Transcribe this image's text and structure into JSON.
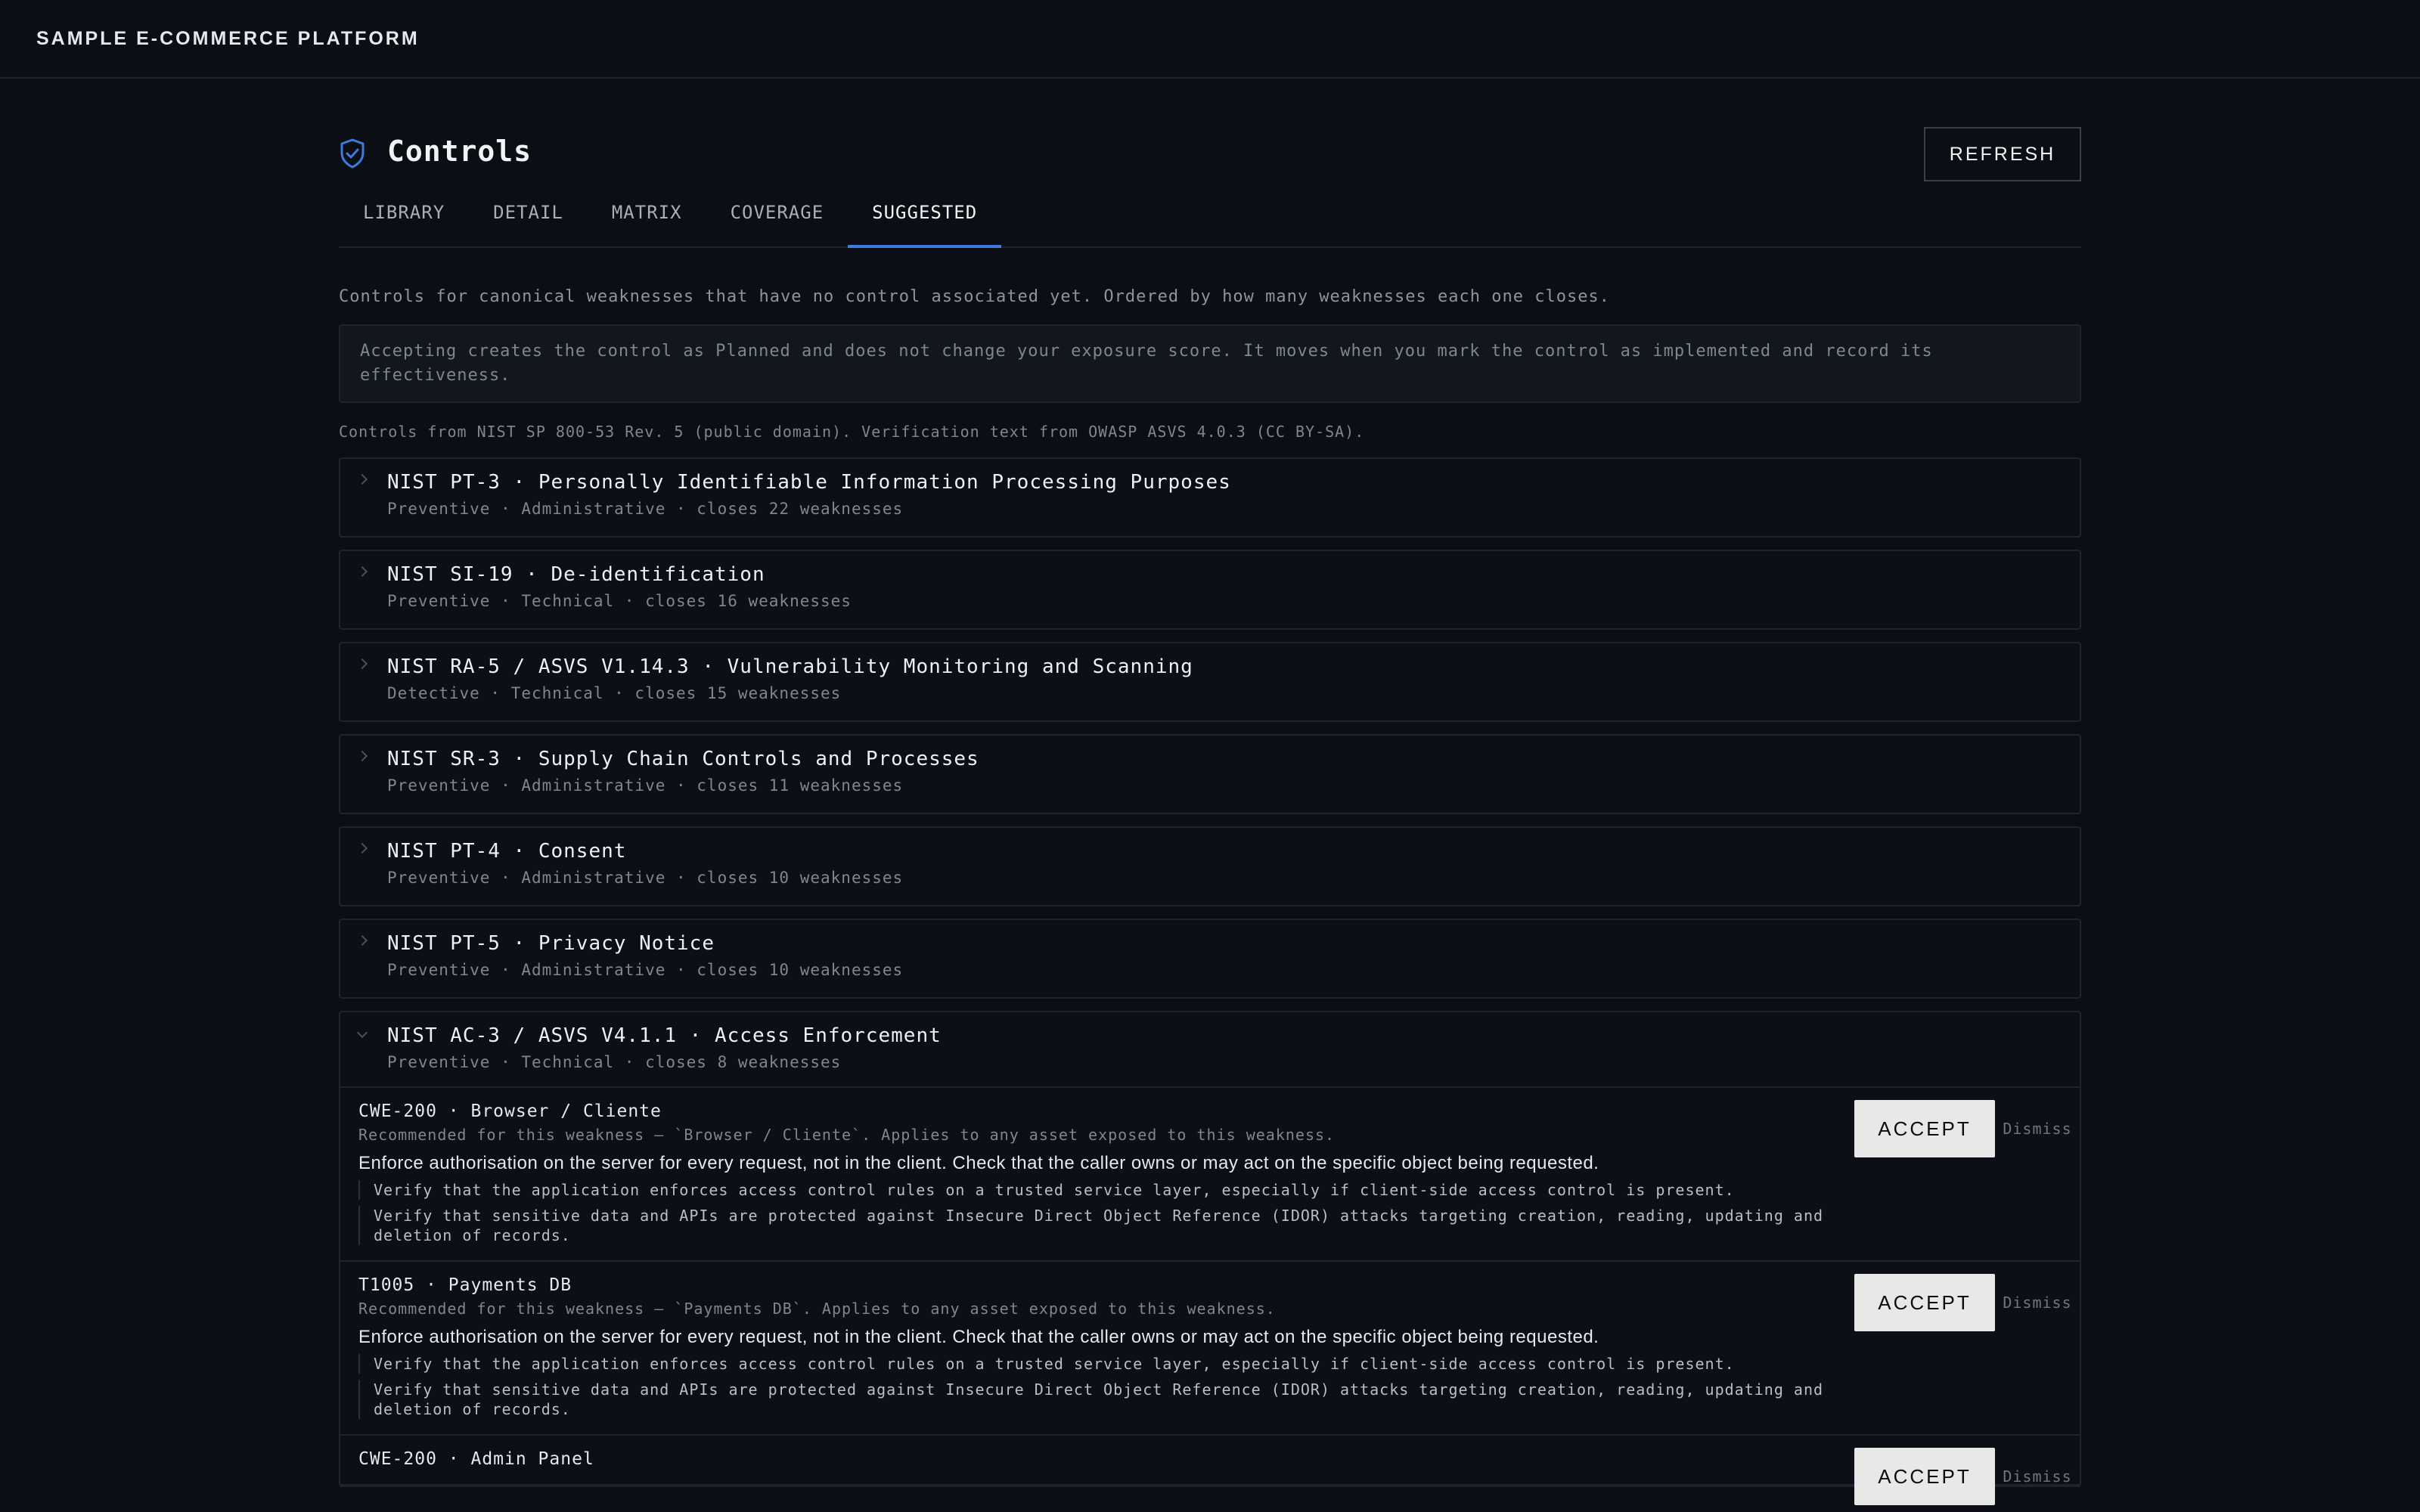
{
  "app": {
    "brand": "SAMPLE E-COMMERCE PLATFORM"
  },
  "header": {
    "title": "Controls",
    "refresh_label": "REFRESH"
  },
  "tabs": [
    {
      "label": "LIBRARY",
      "active": false
    },
    {
      "label": "DETAIL",
      "active": false
    },
    {
      "label": "MATRIX",
      "active": false
    },
    {
      "label": "COVERAGE",
      "active": false
    },
    {
      "label": "SUGGESTED",
      "active": true
    }
  ],
  "intro": "Controls for canonical weaknesses that have no control associated yet. Ordered by how many weaknesses each one closes.",
  "notice": "Accepting creates the control as Planned and does not change your exposure score. It moves when you mark the control as implemented and record its effectiveness.",
  "source": "Controls from NIST SP 800-53 Rev. 5 (public domain). Verification text from OWASP ASVS 4.0.3 (CC BY-SA).",
  "suggestions": [
    {
      "title": "NIST PT-3 · Personally Identifiable Information Processing Purposes",
      "meta": "Preventive · Administrative · closes 22 weaknesses"
    },
    {
      "title": "NIST SI-19 · De-identification",
      "meta": "Preventive · Technical · closes 16 weaknesses"
    },
    {
      "title": "NIST RA-5 / ASVS V1.14.3 · Vulnerability Monitoring and Scanning",
      "meta": "Detective · Technical · closes 15 weaknesses"
    },
    {
      "title": "NIST SR-3 · Supply Chain Controls and Processes",
      "meta": "Preventive · Administrative · closes 11 weaknesses"
    },
    {
      "title": "NIST PT-4 · Consent",
      "meta": "Preventive · Administrative · closes 10 weaknesses"
    },
    {
      "title": "NIST PT-5 · Privacy Notice",
      "meta": "Preventive · Administrative · closes 10 weaknesses"
    },
    {
      "title": "NIST AC-3 / ASVS V4.1.1 · Access Enforcement",
      "meta": "Preventive · Technical · closes 8 weaknesses",
      "recommendations": [
        {
          "target": "CWE-200 · Browser / Cliente",
          "reason": "Recommended for this weakness — `Browser / Cliente`. Applies to any asset exposed to this weakness.",
          "summary": "Enforce authorisation on the server for every request, not in the client. Check that the caller owns or may act on the specific object being requested.",
          "verify_1": "Verify that the application enforces access control rules on a trusted service layer, especially if client-side access control is present.",
          "verify_2": "Verify that sensitive data and APIs are protected against Insecure Direct Object Reference (IDOR) attacks targeting creation, reading, updating and deletion of records.",
          "accept_label": "ACCEPT",
          "dismiss_label": "Dismiss"
        },
        {
          "target": "T1005 · Payments DB",
          "reason": "Recommended for this weakness — `Payments DB`. Applies to any asset exposed to this weakness.",
          "summary": "Enforce authorisation on the server for every request, not in the client. Check that the caller owns or may act on the specific object being requested.",
          "verify_1": "Verify that the application enforces access control rules on a trusted service layer, especially if client-side access control is present.",
          "verify_2": "Verify that sensitive data and APIs are protected against Insecure Direct Object Reference (IDOR) attacks targeting creation, reading, updating and deletion of records.",
          "accept_label": "ACCEPT",
          "dismiss_label": "Dismiss"
        },
        {
          "target": "CWE-200 · Admin Panel",
          "accept_label": "ACCEPT",
          "dismiss_label": "Dismiss"
        }
      ]
    }
  ],
  "colors": {
    "accent": "#3d7be0",
    "background": "#0b0e14"
  },
  "icons": {
    "header": "shield-check-icon",
    "collapse": "chevron-right-icon"
  }
}
